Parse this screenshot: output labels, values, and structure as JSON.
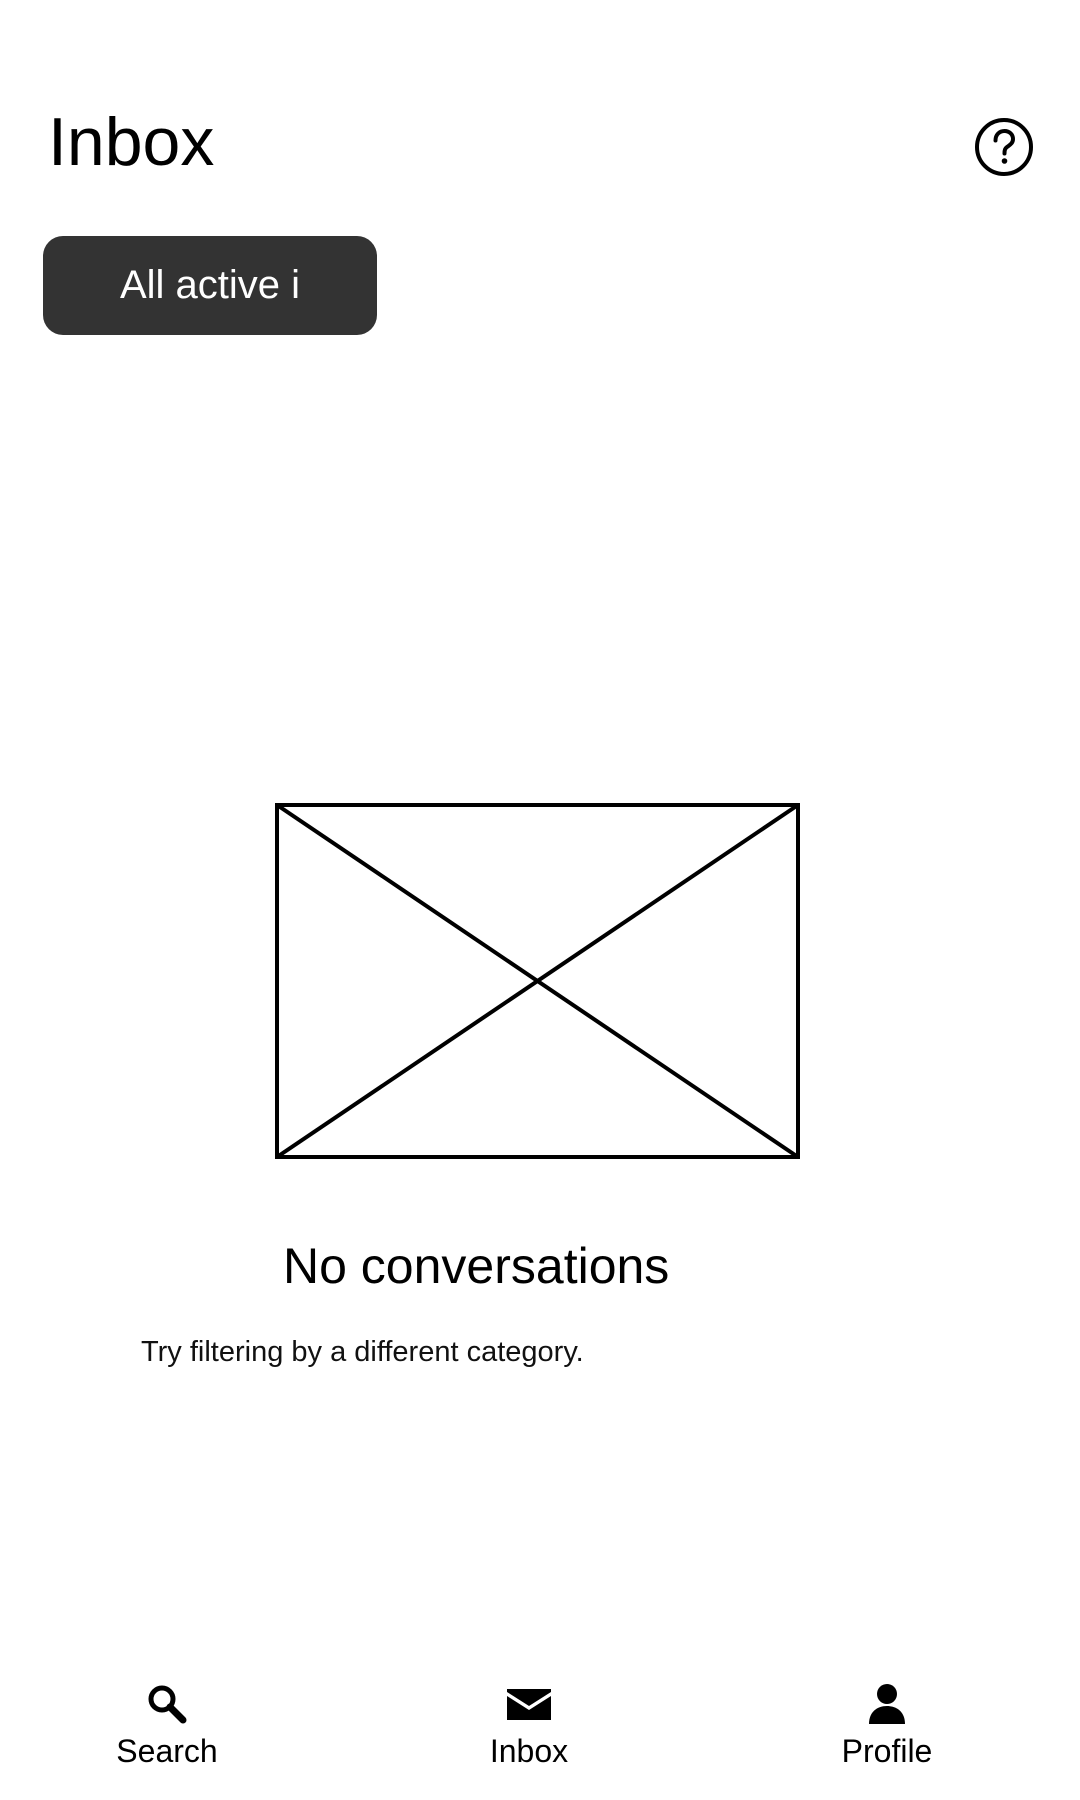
{
  "header": {
    "title": "Inbox",
    "help_icon": "help-circle-icon"
  },
  "filter": {
    "label": "All active i"
  },
  "empty_state": {
    "image_icon": "placeholder-image-icon",
    "title": "No conversations",
    "subtitle": "Try filtering by a different category."
  },
  "bottom_nav": {
    "items": [
      {
        "label": "Search",
        "icon": "search-icon"
      },
      {
        "label": "Inbox",
        "icon": "mail-icon",
        "selected": true
      },
      {
        "label": "Profile",
        "icon": "person-icon"
      }
    ]
  },
  "colors": {
    "background": "#ffffff",
    "filter_button_bg": "#333333",
    "filter_button_text": "#ffffff",
    "text": "#000000"
  }
}
